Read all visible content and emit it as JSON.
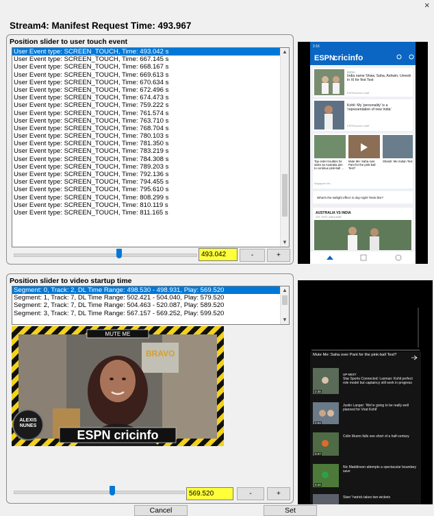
{
  "window": {
    "title": "Stream4: Manifest Request Time: 493.967",
    "close_glyph": "×"
  },
  "touch_section": {
    "label": "Position slider to user touch event",
    "events": [
      "User Event type: SCREEN_TOUCH, Time: 493.042 s",
      "User Event type: SCREEN_TOUCH, Time: 667.145 s",
      "User Event type: SCREEN_TOUCH, Time: 668.167 s",
      "User Event type: SCREEN_TOUCH, Time: 669.613 s",
      "User Event type: SCREEN_TOUCH, Time: 670.634 s",
      "User Event type: SCREEN_TOUCH, Time: 672.496 s",
      "User Event type: SCREEN_TOUCH, Time: 674.473 s",
      "User Event type: SCREEN_TOUCH, Time: 759.222 s",
      "User Event type: SCREEN_TOUCH, Time: 761.574 s",
      "User Event type: SCREEN_TOUCH, Time: 763.710 s",
      "User Event type: SCREEN_TOUCH, Time: 768.704 s",
      "User Event type: SCREEN_TOUCH, Time: 780.103 s",
      "User Event type: SCREEN_TOUCH, Time: 781.350 s",
      "User Event type: SCREEN_TOUCH, Time: 783.219 s",
      "User Event type: SCREEN_TOUCH, Time: 784.308 s",
      "User Event type: SCREEN_TOUCH, Time: 789.203 s",
      "User Event type: SCREEN_TOUCH, Time: 792.136 s",
      "User Event type: SCREEN_TOUCH, Time: 794.455 s",
      "User Event type: SCREEN_TOUCH, Time: 795.610 s",
      "User Event type: SCREEN_TOUCH, Time: 808.299 s",
      "User Event type: SCREEN_TOUCH, Time: 810.119 s",
      "User Event type: SCREEN_TOUCH, Time: 811.165 s"
    ],
    "slider_value": "493.042",
    "slider_fraction": 0.58,
    "minus_label": "-",
    "plus_label": "+"
  },
  "phone": {
    "status_time": "2:16",
    "app_name": "cricinfo",
    "brand_prefix": "ESPN",
    "story1_tag": "INDIA",
    "story1_headline": "India name Shaw, Saha, Ashwin, Umesh in XI for first Test",
    "story1_author": "ESPNcricinfo staff",
    "story2_headline": "Kohli: My 'personality' is a 'representation of new India'",
    "story2_author": "ESPNcricinfo staff",
    "card1": "Top order troubles for sides as Australia aim to continue pink-ball ...",
    "card1_meta": "Alagappan Mu...",
    "card2": "Mute Me: Saha over Pant for the pink-ball Test?",
    "card3": "Shastri: Me Indian Test",
    "twilight": "What's the twilight effect in day-night Tests like?",
    "match_title": "AUSTRALIA VS INDIA",
    "match_sub": "1ST TEST, ADELAIDE"
  },
  "startup_section": {
    "label": "Position slider to video startup time",
    "segments": [
      "Segment: 0, Track: 2, DL Time Range: 498.530 - 498.931, Play: 569.520",
      "Segment: 1, Track: 7, DL Time Range: 502.421 - 504.040, Play: 579.520",
      "Segment: 2, Track: 7, DL Time Range: 504.463 - 520.087, Play: 589.520",
      "Segment: 3, Track: 7, DL Time Range: 567.157 - 569.252, Play: 599.520"
    ],
    "video_overlay_top": "MUTE ME",
    "video_badge": "ALEXIS NUNES",
    "video_logo": "ESPN cricinfo",
    "video_sign": "BRAVO",
    "slider_value": "569.520",
    "slider_fraction": 0.58,
    "minus_label": "-",
    "plus_label": "+"
  },
  "player_phone": {
    "video_title": "Mute Me: Saha over Pant for the pink-ball Test?",
    "up_next_label": "UP NEXT",
    "items": [
      {
        "text": "Star Sports Connected: Laxman: Kohli perfect role model but captaincy still work in progress",
        "dur": "2:35"
      },
      {
        "text": "Justin Langer: 'We're going to be really well planned for Virat Kohli'",
        "dur": "2:04"
      },
      {
        "text": "Colin Munro falls one short of a half-century",
        "dur": "0:37"
      },
      {
        "text": "Nic Maddinson attempts a spectacular boundary save",
        "dur": "0:40"
      },
      {
        "text": "Starc' hatrick takes two wickets",
        "dur": ""
      }
    ]
  },
  "footer": {
    "cancel_label": "Cancel",
    "set_label": "Set"
  },
  "colors": {
    "selection": "#0078d7",
    "highlight": "#ffff3a",
    "app_bar": "#0a66c2"
  }
}
